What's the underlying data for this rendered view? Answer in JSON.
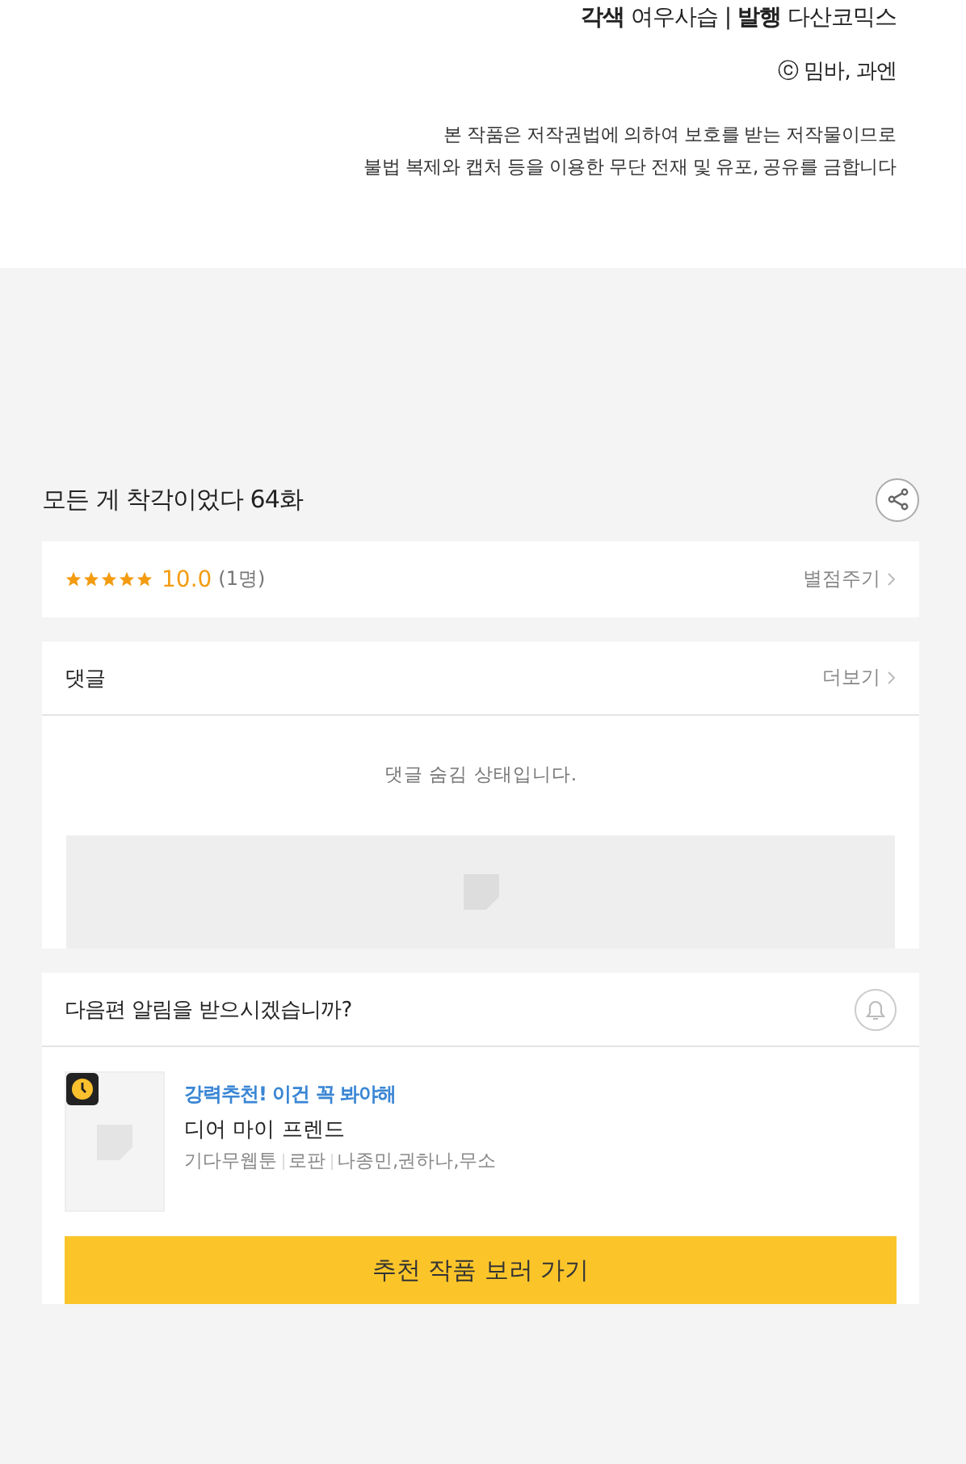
{
  "credits": {
    "line": "**각색** 여우사습 | **발행** 다산코믹스",
    "copyright": "ⓒ 밈바, 과엔",
    "notice": [
      "본 작품은 저작권법에 의하여 보호를 받는 저작물이므로",
      "불법 복제와 캡처 등을 이용한 무단 전재 및 유포, 공유를 금합니다"
    ]
  },
  "episode": {
    "title": "모든 게 착각이었다 64화"
  },
  "rating": {
    "stars": 5,
    "score": "10.0",
    "count": "(1명)",
    "action": "별점주기"
  },
  "comments": {
    "title": "댓글",
    "more": "더보기",
    "empty_message": "댓글 숨김 상태입니다."
  },
  "next": {
    "question": "다음편 알림을 받으시겠습니까?",
    "recommendation": {
      "tagline": "강력추천! 이건 꼭 봐야해",
      "title": "디어 마이 프렌드",
      "tags": [
        "기다무웹툰",
        "로판",
        "나종민,권하나,무소"
      ]
    },
    "button": "추천 작품 보러 가기"
  }
}
